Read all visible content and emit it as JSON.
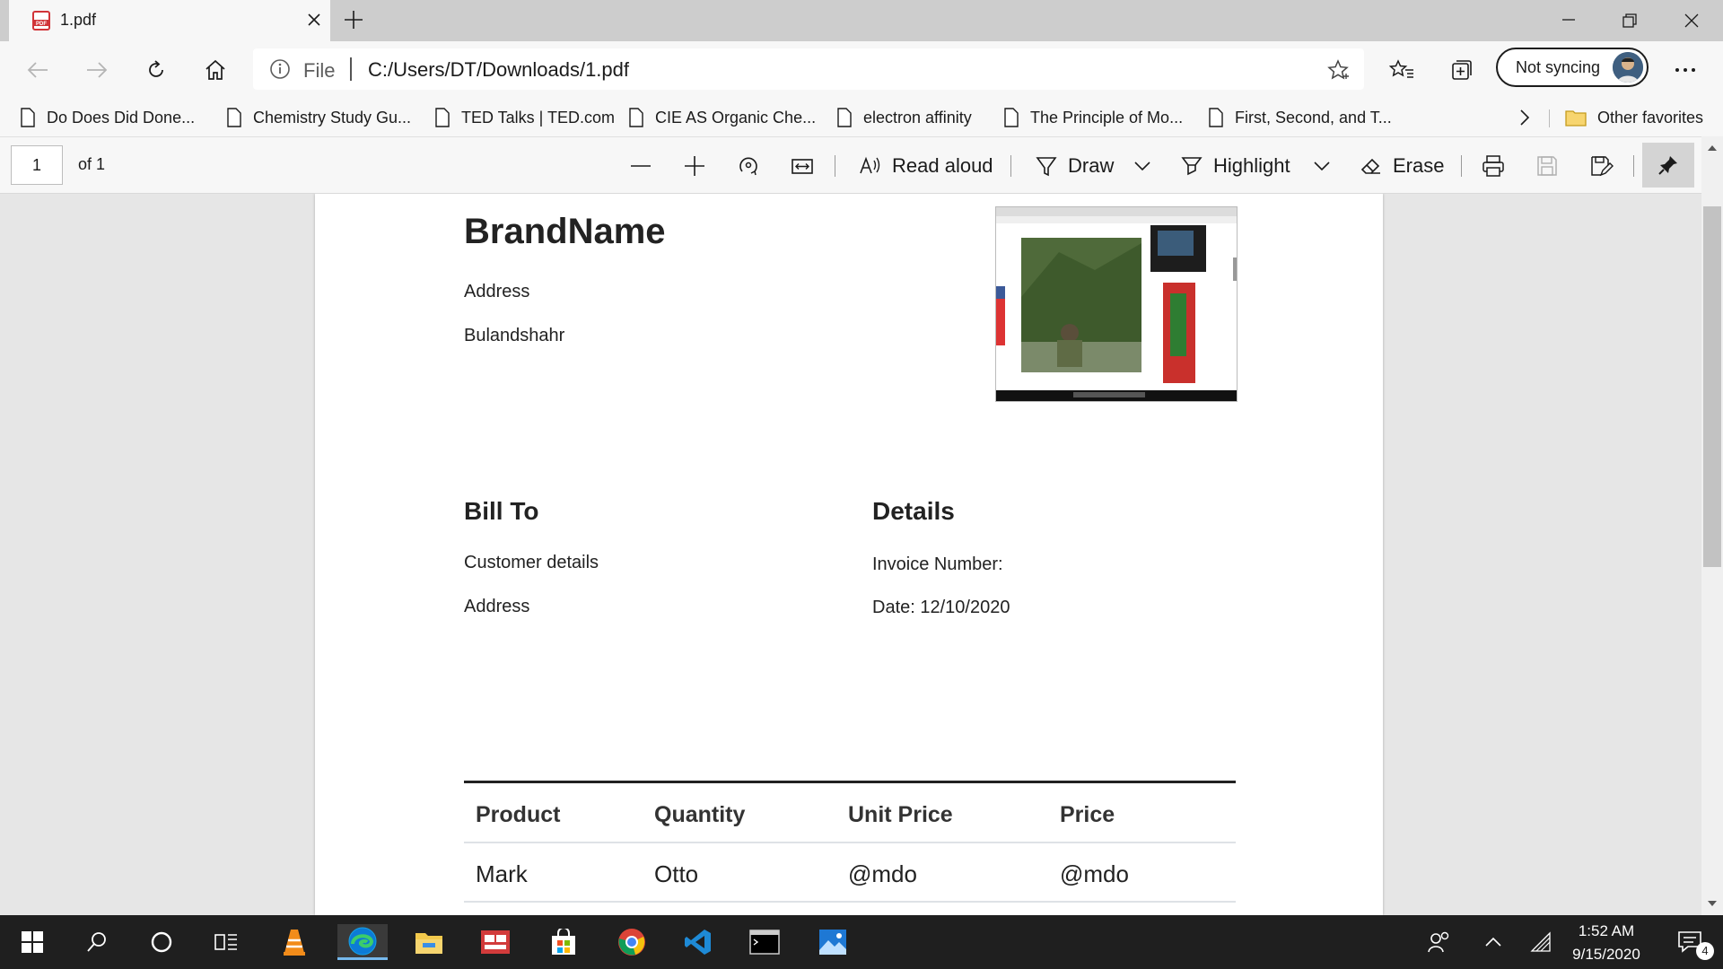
{
  "tab": {
    "title": "1.pdf",
    "close_icon": "close-icon"
  },
  "address": {
    "scheme_label": "File",
    "url": "C:/Users/DT/Downloads/1.pdf"
  },
  "profile": {
    "sync_label": "Not syncing"
  },
  "bookmarks": [
    {
      "label": "Do Does Did Done..."
    },
    {
      "label": "Chemistry Study Gu..."
    },
    {
      "label": "TED Talks | TED.com"
    },
    {
      "label": "CIE AS Organic Che..."
    },
    {
      "label": "electron affinity"
    },
    {
      "label": "The Principle of Mo..."
    },
    {
      "label": "First, Second, and T..."
    }
  ],
  "other_favorites": "Other favorites",
  "pdf_toolbar": {
    "page_number": "1",
    "page_of": "of 1",
    "read_aloud": "Read aloud",
    "draw": "Draw",
    "highlight": "Highlight",
    "erase": "Erase"
  },
  "document": {
    "brand": "BrandName",
    "address": "Address",
    "city": "Bulandshahr",
    "bill_to": {
      "heading": "Bill To",
      "line1": "Customer details",
      "line2": "Address"
    },
    "details": {
      "heading": "Details",
      "invoice_number": "Invoice Number:",
      "date": "Date: 12/10/2020"
    },
    "table": {
      "headers": [
        "Product",
        "Quantity",
        "Unit Price",
        "Price"
      ],
      "rows": [
        [
          "Mark",
          "Otto",
          "@mdo",
          "@mdo"
        ]
      ]
    }
  },
  "taskbar": {
    "time": "1:52 AM",
    "date": "9/15/2020",
    "notification_count": "4"
  },
  "colors": {
    "accent_red": "#d83b01",
    "edge_blue": "#0c7bd6",
    "taskbar": "#1f1f1f"
  }
}
